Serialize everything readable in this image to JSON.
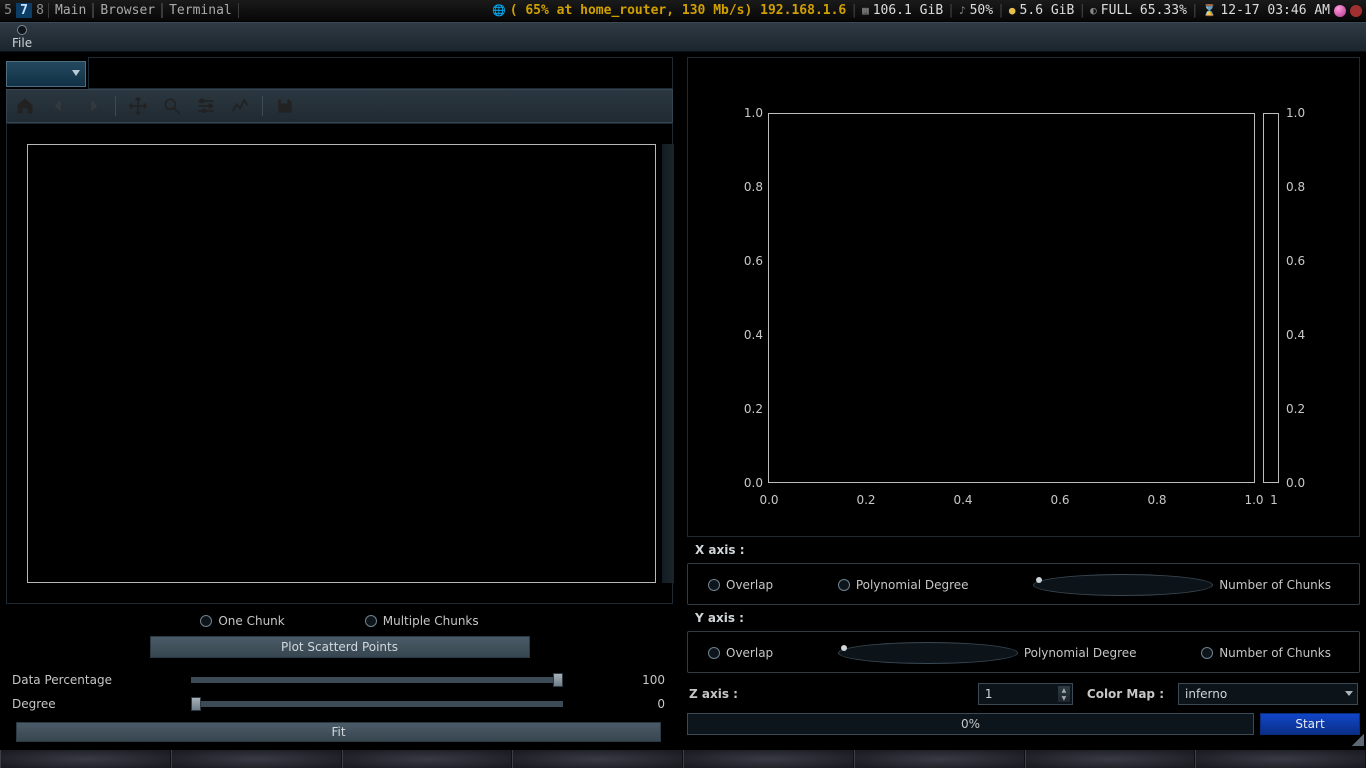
{
  "sysbar": {
    "workspaces": [
      "5",
      "7",
      "8"
    ],
    "active_ws_index": 1,
    "tabs": [
      "Main",
      "Browser",
      "Terminal"
    ],
    "net_icon": "globe-icon",
    "net": "( 65% at home_router, 130 Mb/s) 192.168.1.6",
    "mem": "106.1 GiB",
    "music_icon": "♪",
    "music_pct": "50%",
    "disk_icon": "●",
    "disk": "5.6 GiB",
    "cpu_icon": "◐",
    "cpu": "FULL 65.33%",
    "hour_icon": "⌛",
    "clock": "12-17 03:46 AM"
  },
  "menubar": {
    "file": "File"
  },
  "left": {
    "combo_value": "",
    "nav_icons": [
      "home-icon",
      "back-icon",
      "forward-icon",
      "sep",
      "move-icon",
      "zoom-icon",
      "sliders-icon",
      "lineplot-icon",
      "sep",
      "save-icon"
    ],
    "chunk_mode": {
      "one": "One Chunk",
      "multiple": "Multiple Chunks",
      "selected": null
    },
    "plot_button": "Plot Scatterd Points",
    "data_pct_label": "Data Percentage",
    "data_pct_value": "100",
    "degree_label": "Degree",
    "degree_value": "0",
    "fit_button": "Fit"
  },
  "right": {
    "x_label": "X axis :",
    "y_label": "Y axis :",
    "z_label": "Z axis :",
    "opts": {
      "overlap": "Overlap",
      "poly": "Polynomial Degree",
      "chunks": "Number of Chunks"
    },
    "x_sel": null,
    "y_sel": "poly",
    "z_value": "1",
    "cmap_label": "Color Map :",
    "cmap_value": "inferno",
    "progress": "0%",
    "start": "Start"
  },
  "chart_data": {
    "type": "scatter",
    "series": [],
    "xlim": [
      0.0,
      1.0
    ],
    "ylim": [
      0.0,
      1.0
    ],
    "x_ticks": [
      "0.0",
      "0.2",
      "0.4",
      "0.6",
      "0.8",
      "1.0"
    ],
    "y_ticks": [
      "0.0",
      "0.2",
      "0.4",
      "0.6",
      "0.8",
      "1.0"
    ],
    "colorbar": {
      "ticks": [
        "0.0",
        "0.2",
        "0.4",
        "0.6",
        "0.8",
        "1.0"
      ],
      "range": [
        0.0,
        1.0
      ],
      "x_tick": "1"
    }
  }
}
